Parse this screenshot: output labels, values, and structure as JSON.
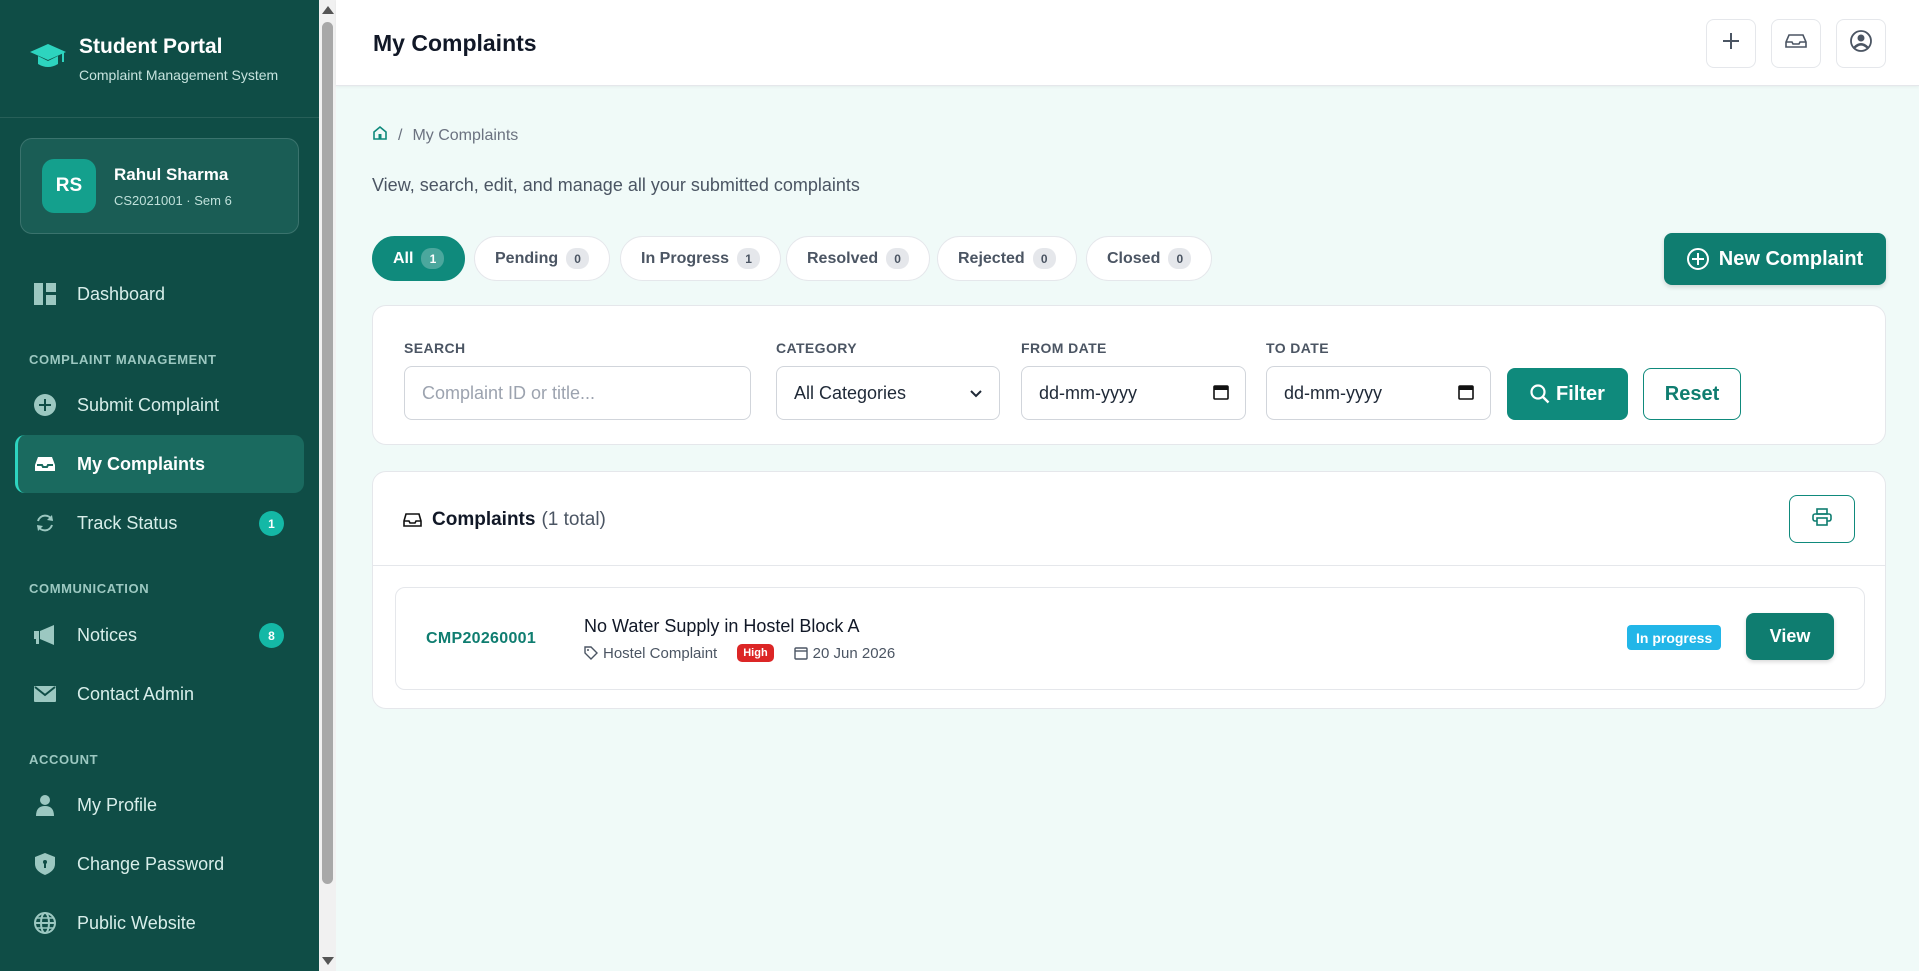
{
  "brand": {
    "title": "Student Portal",
    "subtitle": "Complaint Management System",
    "icon": "graduation-cap-icon"
  },
  "user": {
    "initials": "RS",
    "name": "Rahul Sharma",
    "meta": "CS2021001 · Sem 6"
  },
  "nav": {
    "dashboard": "Dashboard",
    "section_complaint": "COMPLAINT MANAGEMENT",
    "submit": "Submit Complaint",
    "my_complaints": "My Complaints",
    "track": "Track Status",
    "track_badge": "1",
    "section_comm": "COMMUNICATION",
    "notices": "Notices",
    "notices_badge": "8",
    "contact": "Contact Admin",
    "section_account": "ACCOUNT",
    "profile": "My Profile",
    "password": "Change Password",
    "website": "Public Website"
  },
  "header": {
    "title": "My Complaints"
  },
  "breadcrumb": {
    "sep": "/",
    "current": "My Complaints"
  },
  "subtitle": "View, search, edit, and manage all your submitted complaints",
  "tabs": [
    {
      "label": "All",
      "count": "1"
    },
    {
      "label": "Pending",
      "count": "0"
    },
    {
      "label": "In Progress",
      "count": "1"
    },
    {
      "label": "Resolved",
      "count": "0"
    },
    {
      "label": "Rejected",
      "count": "0"
    },
    {
      "label": "Closed",
      "count": "0"
    }
  ],
  "new_complaint": "New Complaint",
  "filters": {
    "search_label": "SEARCH",
    "search_placeholder": "Complaint ID or title...",
    "category_label": "CATEGORY",
    "category_value": "All Categories",
    "from_label": "FROM DATE",
    "from_value": "dd-mm-yyyy",
    "to_label": "TO DATE",
    "to_value": "dd-mm-yyyy",
    "filter_btn": "Filter",
    "reset_btn": "Reset"
  },
  "list": {
    "title": "Complaints",
    "total": "(1 total)",
    "rows": [
      {
        "id": "CMP20260001",
        "title": "No Water Supply in Hostel Block A",
        "category": "Hostel Complaint",
        "priority": "High",
        "date": "20 Jun 2026",
        "status": "In progress",
        "action": "View"
      }
    ]
  },
  "colors": {
    "primary": "#0f7d70",
    "sidebar": "#0f4d46",
    "status_in_progress": "#22b6e8",
    "priority_high": "#dc2626"
  }
}
